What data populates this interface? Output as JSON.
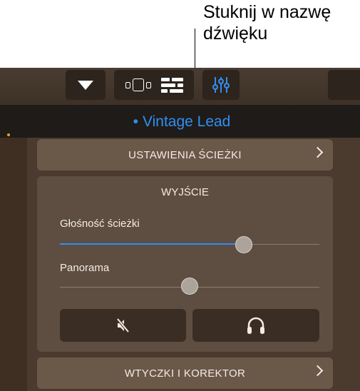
{
  "callout": {
    "line1": "Stuknij w nazwę",
    "line2": "dźwięku"
  },
  "toolbar": {
    "dropdown_icon": "triangle-down-icon",
    "views_icons": [
      "live-loops-icon",
      "tracks-view-icon"
    ],
    "mixer_icon": "mixer-sliders-icon"
  },
  "track": {
    "bullet": "•",
    "name": "Vintage Lead"
  },
  "panel": {
    "track_settings_label": "USTAWIENIA ŚCIEŻKI",
    "output_title": "WYJŚCIE",
    "volume_label": "Głośność ścieżki",
    "volume_value": 0.71,
    "pan_label": "Panorama",
    "pan_value": 0.5,
    "mute_icon": "speaker-mute-icon",
    "solo_icon": "headphones-icon",
    "plugins_label": "WTYCZKI I KOREKTOR"
  },
  "colors": {
    "accent": "#2f8ff5",
    "panel": "#4b3b2e",
    "button": "#6a5849"
  }
}
